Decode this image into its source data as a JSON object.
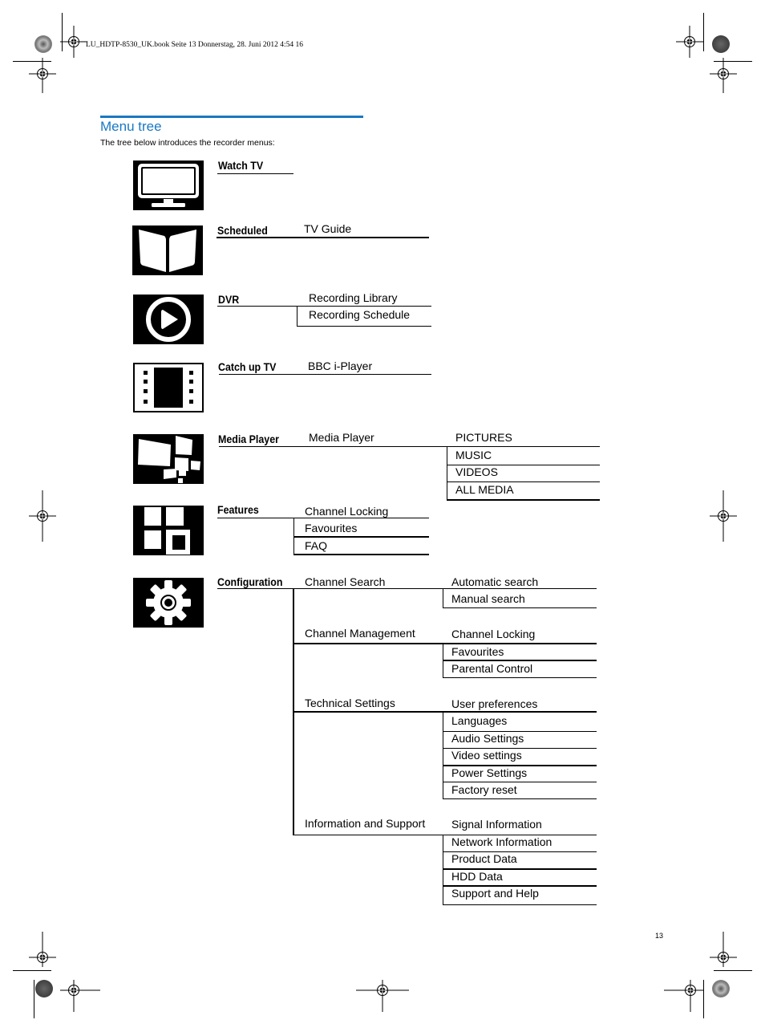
{
  "print_header": "LU_HDTP-8530_UK.book  Seite 13  Donnerstag, 28. Juni 2012  4:54 16",
  "page_title": "Menu tree",
  "intro_text": "The tree below introduces the recorder menus:",
  "page_number": "13",
  "accent_color": "#1a78c2",
  "menu_tree": [
    {
      "label": "Watch TV",
      "icon": "tv-icon",
      "children": []
    },
    {
      "label": "Scheduled",
      "icon": "book-icon",
      "children": [
        {
          "label": "TV Guide",
          "children": []
        }
      ]
    },
    {
      "label": "DVR",
      "icon": "play-icon",
      "children": [
        {
          "label": "Recording Library",
          "children": []
        },
        {
          "label": "Recording Schedule",
          "children": []
        }
      ]
    },
    {
      "label": "Catch up TV",
      "icon": "film-icon",
      "children": [
        {
          "label": "BBC i-Player",
          "children": []
        }
      ]
    },
    {
      "label": "Media Player",
      "icon": "media-tiles-icon",
      "children": [
        {
          "label": "Media Player",
          "children": [
            {
              "label": "PICTURES"
            },
            {
              "label": "MUSIC"
            },
            {
              "label": "VIDEOS"
            },
            {
              "label": "ALL MEDIA"
            }
          ]
        }
      ]
    },
    {
      "label": "Features",
      "icon": "grid-icon",
      "children": [
        {
          "label": "Channel Locking",
          "children": []
        },
        {
          "label": "Favourites",
          "children": []
        },
        {
          "label": "FAQ",
          "children": []
        }
      ]
    },
    {
      "label": "Configuration",
      "icon": "gear-icon",
      "children": [
        {
          "label": "Channel Search",
          "children": [
            {
              "label": "Automatic search"
            },
            {
              "label": "Manual search"
            }
          ]
        },
        {
          "label": "Channel Management",
          "children": [
            {
              "label": "Channel Locking"
            },
            {
              "label": "Favourites"
            },
            {
              "label": "Parental Control"
            }
          ]
        },
        {
          "label": "Technical Settings",
          "children": [
            {
              "label": "User preferences"
            },
            {
              "label": "Languages"
            },
            {
              "label": "Audio Settings"
            },
            {
              "label": "Video settings"
            },
            {
              "label": "Power Settings"
            },
            {
              "label": "Factory reset"
            }
          ]
        },
        {
          "label": "Information and Support",
          "children": [
            {
              "label": "Signal Information"
            },
            {
              "label": "Network Information"
            },
            {
              "label": "Product Data"
            },
            {
              "label": "HDD Data"
            },
            {
              "label": "Support and Help"
            }
          ]
        }
      ]
    }
  ]
}
